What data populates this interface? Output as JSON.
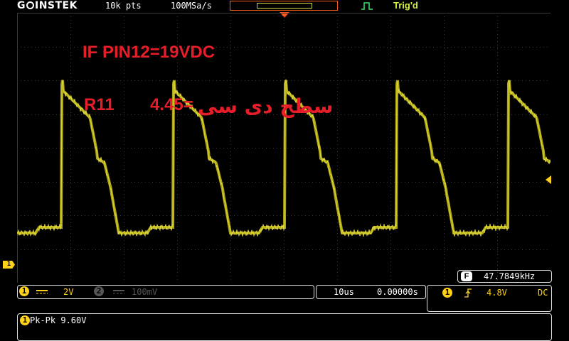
{
  "header": {
    "brand": "GWINSTEK",
    "record_length": "10k pts",
    "sample_rate": "100MSa/s",
    "trigger_status": "Trig'd"
  },
  "annotations": {
    "line1": "IF PIN12=19VDC",
    "line2_label": "R11",
    "line2_value": "4.45=",
    "line2_persian": "سطح دی سی"
  },
  "ch1_marker": "1",
  "frequency": {
    "icon": "F",
    "value": "47.7849kHz"
  },
  "channel1": {
    "number": "1",
    "coupling_icon": "dc-coupling-icon",
    "scale": "2V"
  },
  "channel2": {
    "number": "2",
    "coupling_icon": "dc-coupling-icon",
    "scale": "100mV"
  },
  "timebase": {
    "scale": "10us",
    "position": "0.00000s"
  },
  "trigger": {
    "source": "1",
    "slope_icon": "rising-edge-icon",
    "level": "4.8V",
    "coupling": "DC"
  },
  "measurement": {
    "channel": "1",
    "text": "Pk-Pk 9.60V"
  },
  "colors": {
    "ch1": "#ffd21a",
    "annotation": "#e81d2a",
    "trigger_marker": "#ff5a1a",
    "trace": "#c9c213"
  }
}
